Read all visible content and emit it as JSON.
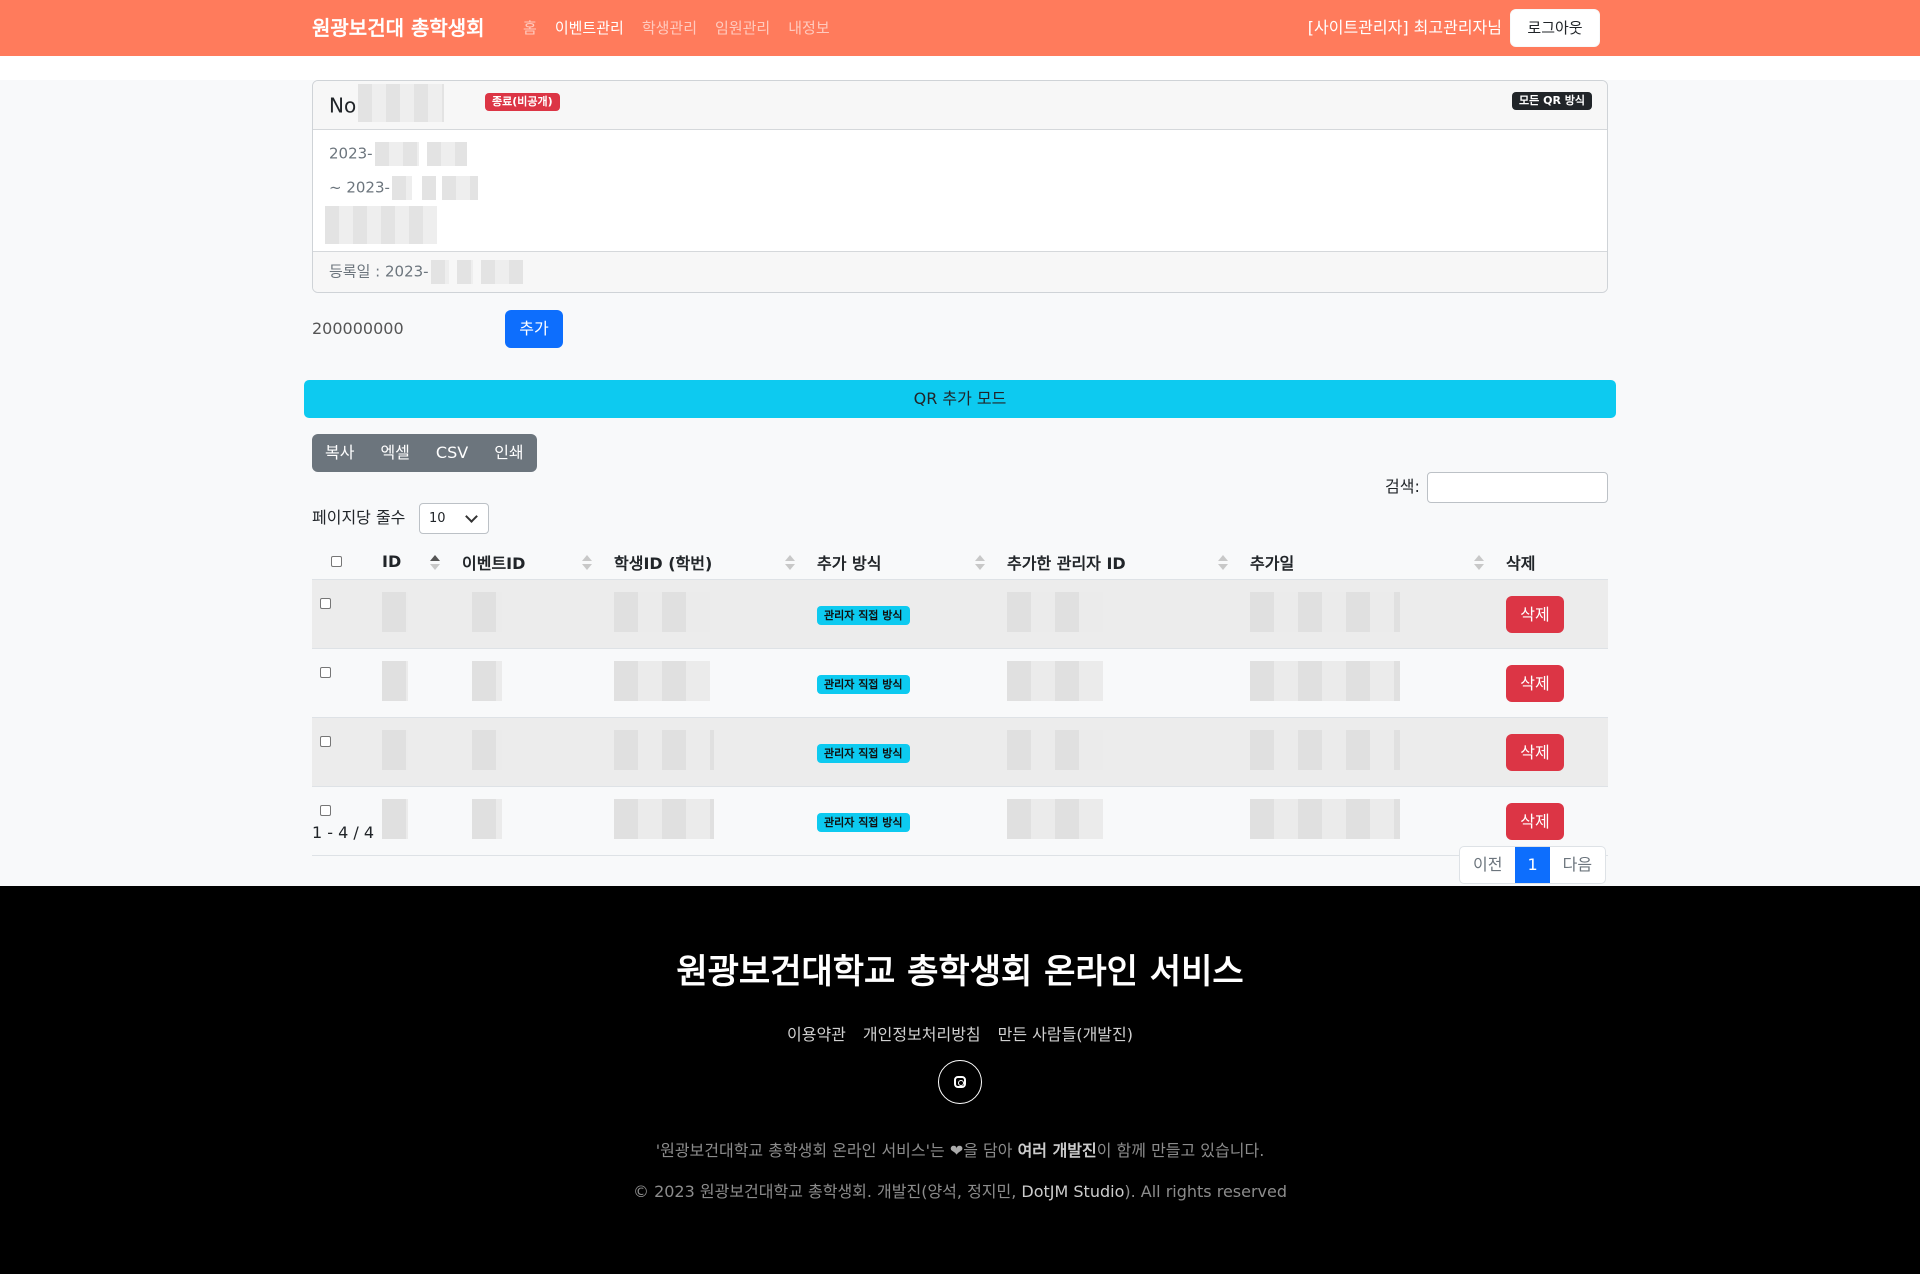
{
  "navbar": {
    "brand": "원광보건대 총학생회",
    "links": [
      {
        "label": "홈"
      },
      {
        "label": "이벤트관리",
        "active": true
      },
      {
        "label": "학생관리"
      },
      {
        "label": "임원관리"
      },
      {
        "label": "내정보"
      }
    ],
    "user": "[사이트관리자] 최고관리자님",
    "logout": "로그아웃",
    "color": "#ff7b5c"
  },
  "event": {
    "no_prefix": "No",
    "status_badge": "종료(비공개)",
    "mode_badge": "모든 QR 방식",
    "start_prefix": "2023-",
    "end_prefix": "~ 2023-",
    "registered_label": "등록일 : 2023-"
  },
  "add_form": {
    "student_id": "200000000",
    "add_button": "추가"
  },
  "qr_mode_label": "QR 추가 모드",
  "export_buttons": [
    "복사",
    "엑셀",
    "CSV",
    "인쇄"
  ],
  "search": {
    "label": "검색:",
    "value": ""
  },
  "per_page": {
    "label": "페이지당 줄수",
    "value": "10"
  },
  "table": {
    "columns": [
      "ID",
      "이벤트ID",
      "학생ID (학번)",
      "추가 방식",
      "추가한 관리자 ID",
      "추가일",
      "삭제"
    ],
    "rows": [
      {
        "method": "관리자 직접 방식",
        "delete": "삭제"
      },
      {
        "method": "관리자 직접 방식",
        "delete": "삭제"
      },
      {
        "method": "관리자 직접 방식",
        "delete": "삭제"
      },
      {
        "method": "관리자 직접 방식",
        "delete": "삭제"
      }
    ]
  },
  "table_info": "1 - 4 / 4",
  "pagination": {
    "prev": "이전",
    "current": "1",
    "next": "다음"
  },
  "footer": {
    "title": "원광보건대학교 총학생회 온라인 서비스",
    "links": [
      "이용약관",
      "개인정보처리방침",
      "만든 사람들(개발진)"
    ],
    "note_a": "'원광보건대학교 총학생회 온라인 서비스'는 ",
    "note_b": "을 담아 ",
    "note_bold": "여러 개발진",
    "note_c": "이 함께 만들고 있습니다.",
    "copy_a": "© 2023 원광보건대학교 총학생회. 개발진(양석, 정지민, ",
    "copy_bold": "DotJM Studio",
    "copy_c": "). All rights reserved",
    "icons": [
      "instagram-icon",
      "heart-icon"
    ]
  }
}
